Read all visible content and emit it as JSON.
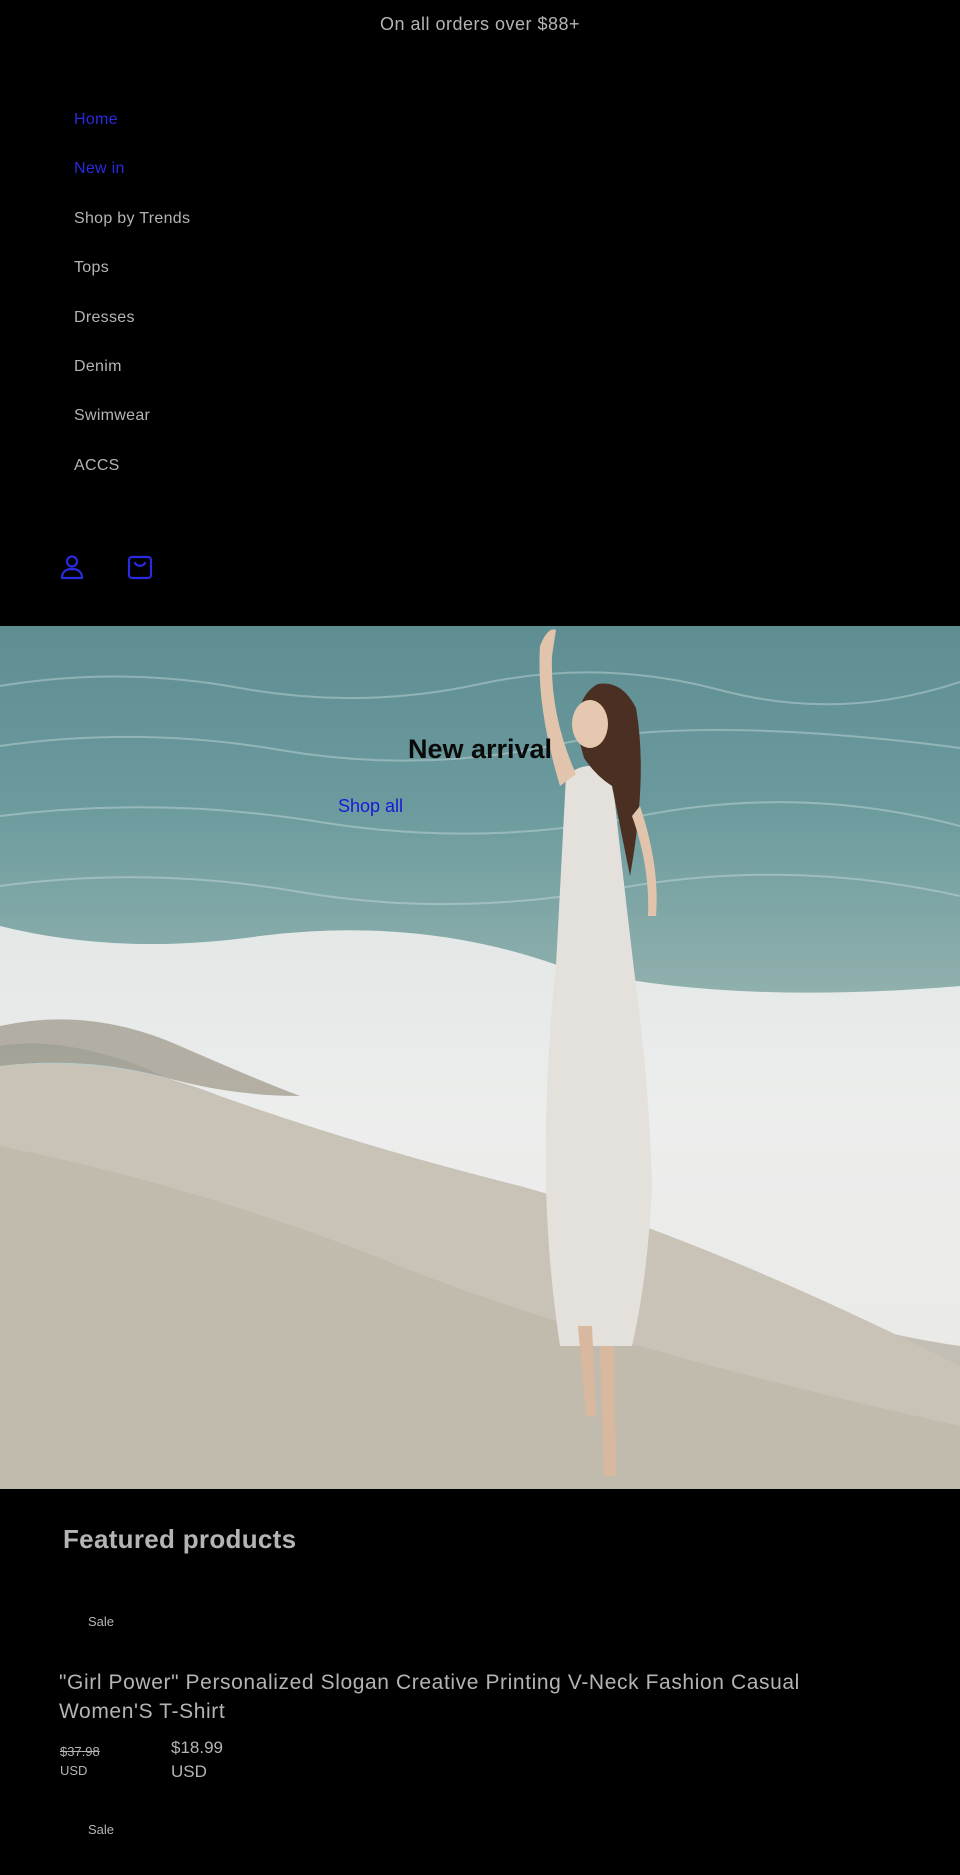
{
  "announcement": "On all orders over $88+",
  "nav": {
    "items": [
      {
        "label": "Home"
      },
      {
        "label": "New in"
      },
      {
        "label": "Shop by Trends"
      },
      {
        "label": "Tops"
      },
      {
        "label": "Dresses"
      },
      {
        "label": "Denim"
      },
      {
        "label": "Swimwear"
      },
      {
        "label": "ACCS"
      }
    ]
  },
  "icons": {
    "account": "account-icon",
    "cart": "cart-icon"
  },
  "hero": {
    "title": "New arrival",
    "link": "Shop all"
  },
  "featured": {
    "title": "Featured products",
    "badges": [
      "Sale",
      "Sale"
    ],
    "product": {
      "title": "\"Girl Power\" Personalized Slogan Creative Printing V-Neck Fashion Casual Women'S T-Shirt",
      "regular_price": "$37.98",
      "regular_currency": "USD",
      "sale_price": "$18.99",
      "sale_currency": "USD"
    }
  },
  "colors": {
    "background": "#000000",
    "text": "#b4b4b4",
    "link": "#1818d8"
  }
}
